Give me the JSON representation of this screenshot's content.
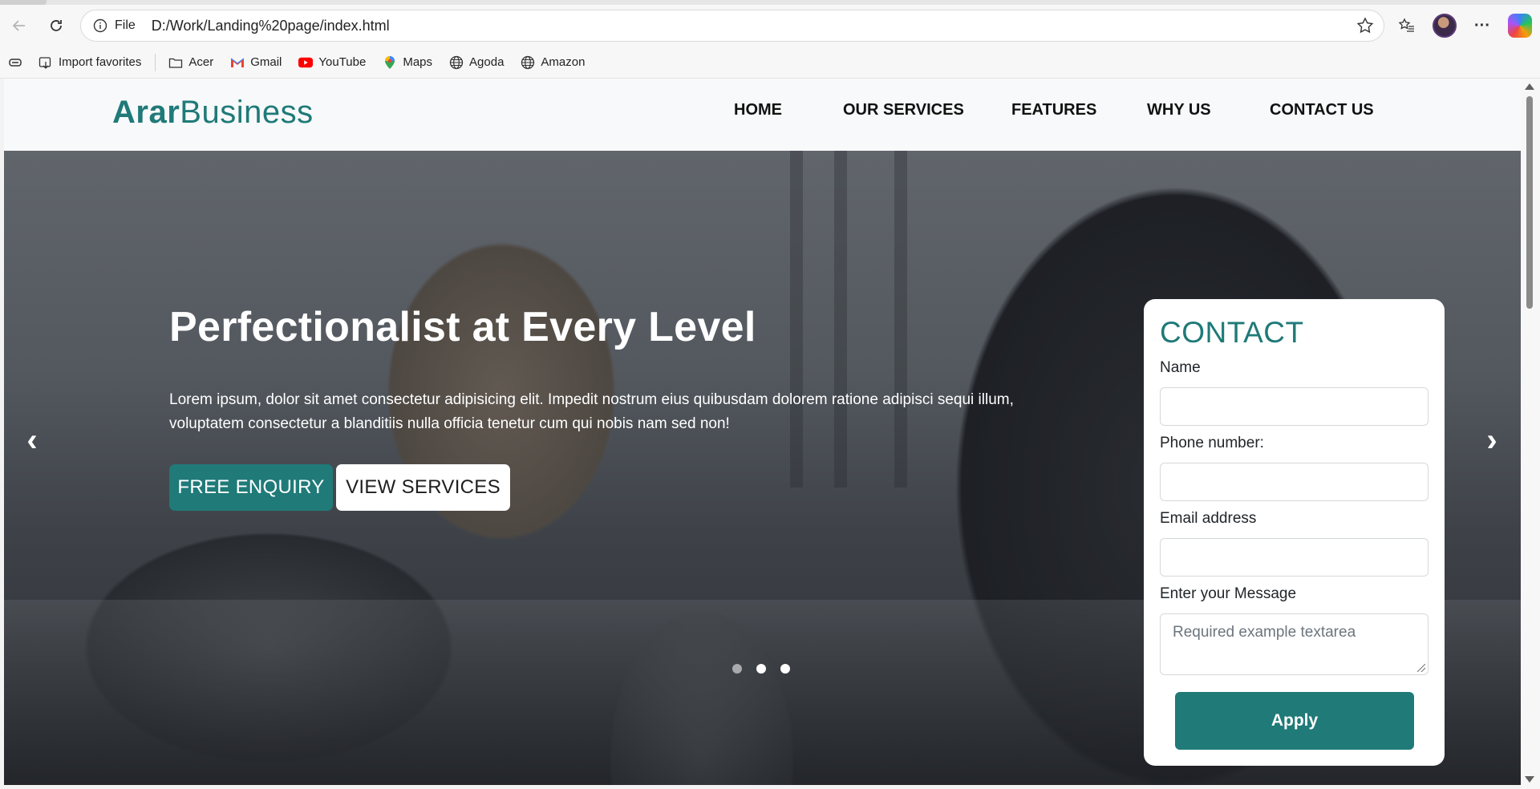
{
  "browser": {
    "address_label": "File",
    "url": "D:/Work/Landing%20page/index.html",
    "favorites": [
      {
        "label": "Import favorites",
        "icon": "import-icon"
      },
      {
        "label": "Acer",
        "icon": "folder-icon"
      },
      {
        "label": "Gmail",
        "icon": "gmail-icon"
      },
      {
        "label": "YouTube",
        "icon": "youtube-icon"
      },
      {
        "label": "Maps",
        "icon": "maps-pin-icon"
      },
      {
        "label": "Agoda",
        "icon": "globe-icon"
      },
      {
        "label": "Amazon",
        "icon": "globe-icon"
      }
    ],
    "more_label": "···"
  },
  "site": {
    "brand_bold": "Arar",
    "brand_rest": "Business",
    "nav": [
      "HOME",
      "OUR SERVICES",
      "FEATURES",
      "WHY US",
      "CONTACT US"
    ]
  },
  "hero": {
    "title": "Perfectionalist at Every Level",
    "text": "Lorem ipsum, dolor sit amet consectetur adipisicing elit. Impedit nostrum eius quibusdam dolorem ratione adipisci sequi illum, voluptatem consectetur a blanditiis nulla officia tenetur cum qui nobis nam sed non!",
    "btn_enquiry": "FREE ENQUIRY",
    "btn_services": "VIEW SERVICES",
    "prev_arrow": "‹",
    "next_arrow": "›",
    "slides": 3,
    "active_slide": 2
  },
  "contact": {
    "title": "CONTACT",
    "name_label": "Name",
    "phone_label": "Phone number:",
    "email_label": "Email address",
    "message_label": "Enter your Message",
    "message_placeholder": "Required example textarea",
    "apply_label": "Apply"
  },
  "colors": {
    "accent": "#1f7a78"
  }
}
